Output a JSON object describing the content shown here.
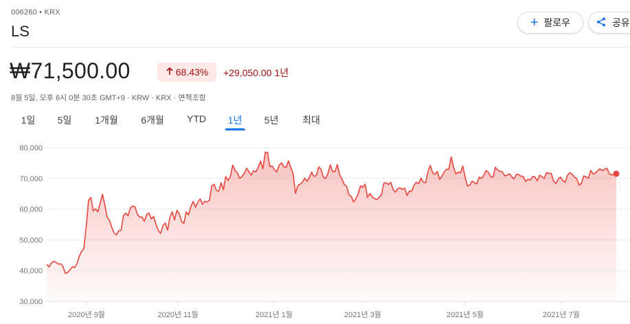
{
  "header": {
    "ticker": "006260 • KRX",
    "name": "LS",
    "follow_label": "팔로우",
    "share_label": "공유"
  },
  "quote": {
    "price": "₩71,500.00",
    "change_pct": "68.43%",
    "change_abs": "+29,050.00",
    "period": "1년",
    "meta": "8월 5일, 오후 6시 0분 30초 GMT+9 · KRW · KRX · 면책조항"
  },
  "tabs": [
    "1일",
    "5일",
    "1개월",
    "6개월",
    "YTD",
    "1년",
    "5년",
    "최대"
  ],
  "active_tab": "1년",
  "colors": {
    "line": "#e8453c",
    "down_text": "#a50e0e",
    "badge_bg": "#fce8e6",
    "accent": "#1a73e8"
  },
  "icons": {
    "follow": "plus-icon",
    "share": "share-icon",
    "badge": "arrow-up-icon"
  },
  "chart_data": {
    "type": "area",
    "ylim": [
      30000,
      80000
    ],
    "yticks": [
      80000,
      70000,
      60000,
      50000,
      40000,
      30000
    ],
    "ytick_labels": [
      "80,000",
      "70,000",
      "60,000",
      "50,000",
      "40,000",
      "30,000"
    ],
    "xticks": [
      "2020년 9월",
      "2020년 11월",
      "2021년 1월",
      "2021년 3월",
      "2021년 5월",
      "2021년 7월"
    ],
    "grid": true,
    "series": [
      {
        "values": [
          42000,
          41200,
          42500,
          43000,
          42700,
          42100,
          42200,
          41300,
          39100,
          39400,
          40200,
          41200,
          41000,
          42200,
          44600,
          46300,
          47100,
          54300,
          62900,
          63800,
          59400,
          60100,
          59100,
          61900,
          64800,
          61300,
          57400,
          56300,
          54100,
          52100,
          51600,
          53000,
          53100,
          57900,
          58700,
          57800,
          60400,
          61000,
          60700,
          58300,
          57400,
          57400,
          56000,
          58200,
          58700,
          56800,
          57600,
          55000,
          53100,
          52100,
          54600,
          55500,
          53100,
          57300,
          59100,
          56500,
          59600,
          58500,
          56000,
          55300,
          59100,
          58100,
          60800,
          62500,
          60600,
          62300,
          63300,
          61600,
          62500,
          62300,
          62900,
          67500,
          68100,
          66100,
          65800,
          68600,
          66300,
          70600,
          69300,
          70600,
          74300,
          72600,
          71800,
          70000,
          70600,
          71600,
          73300,
          72100,
          71100,
          72500,
          72100,
          73600,
          75600,
          73100,
          78500,
          78400,
          73800,
          74000,
          72800,
          72100,
          74300,
          75100,
          73700,
          73600,
          75700,
          73500,
          71400,
          65100,
          67600,
          68100,
          68800,
          70100,
          69000,
          70400,
          72000,
          70600,
          71000,
          73700,
          73000,
          70400,
          69900,
          71700,
          74400,
          72200,
          72200,
          74500,
          71200,
          69800,
          68000,
          67400,
          64700,
          64100,
          62300,
          63400,
          65000,
          67600,
          67100,
          68100,
          63800,
          65100,
          64000,
          63400,
          63100,
          63800,
          64600,
          68400,
          68600,
          68000,
          68700,
          66400,
          65500,
          66600,
          66900,
          66400,
          66800,
          64400,
          65900,
          65800,
          67800,
          68700,
          68300,
          70100,
          68700,
          68600,
          72200,
          74200,
          71800,
          71300,
          72200,
          69700,
          70700,
          72100,
          73000,
          72900,
          77000,
          73700,
          71400,
          72000,
          71800,
          74000,
          70300,
          67500,
          67800,
          69100,
          68600,
          68200,
          70400,
          70000,
          70900,
          72600,
          71900,
          70600,
          70400,
          73600,
          72700,
          72300,
          72100,
          70800,
          71000,
          71500,
          70600,
          69800,
          71300,
          71300,
          70700,
          70600,
          69000,
          69700,
          69400,
          70600,
          70500,
          69200,
          71000,
          70600,
          69900,
          71800,
          71600,
          71600,
          69200,
          68300,
          69700,
          70400,
          69300,
          68700,
          71000,
          71800,
          71400,
          70400,
          69900,
          67800,
          68400,
          70800,
          70500,
          70000,
          72600,
          71400,
          71700,
          72500,
          73100,
          72500,
          73000,
          73300,
          71500,
          71100,
          71300,
          71500
        ]
      }
    ]
  }
}
